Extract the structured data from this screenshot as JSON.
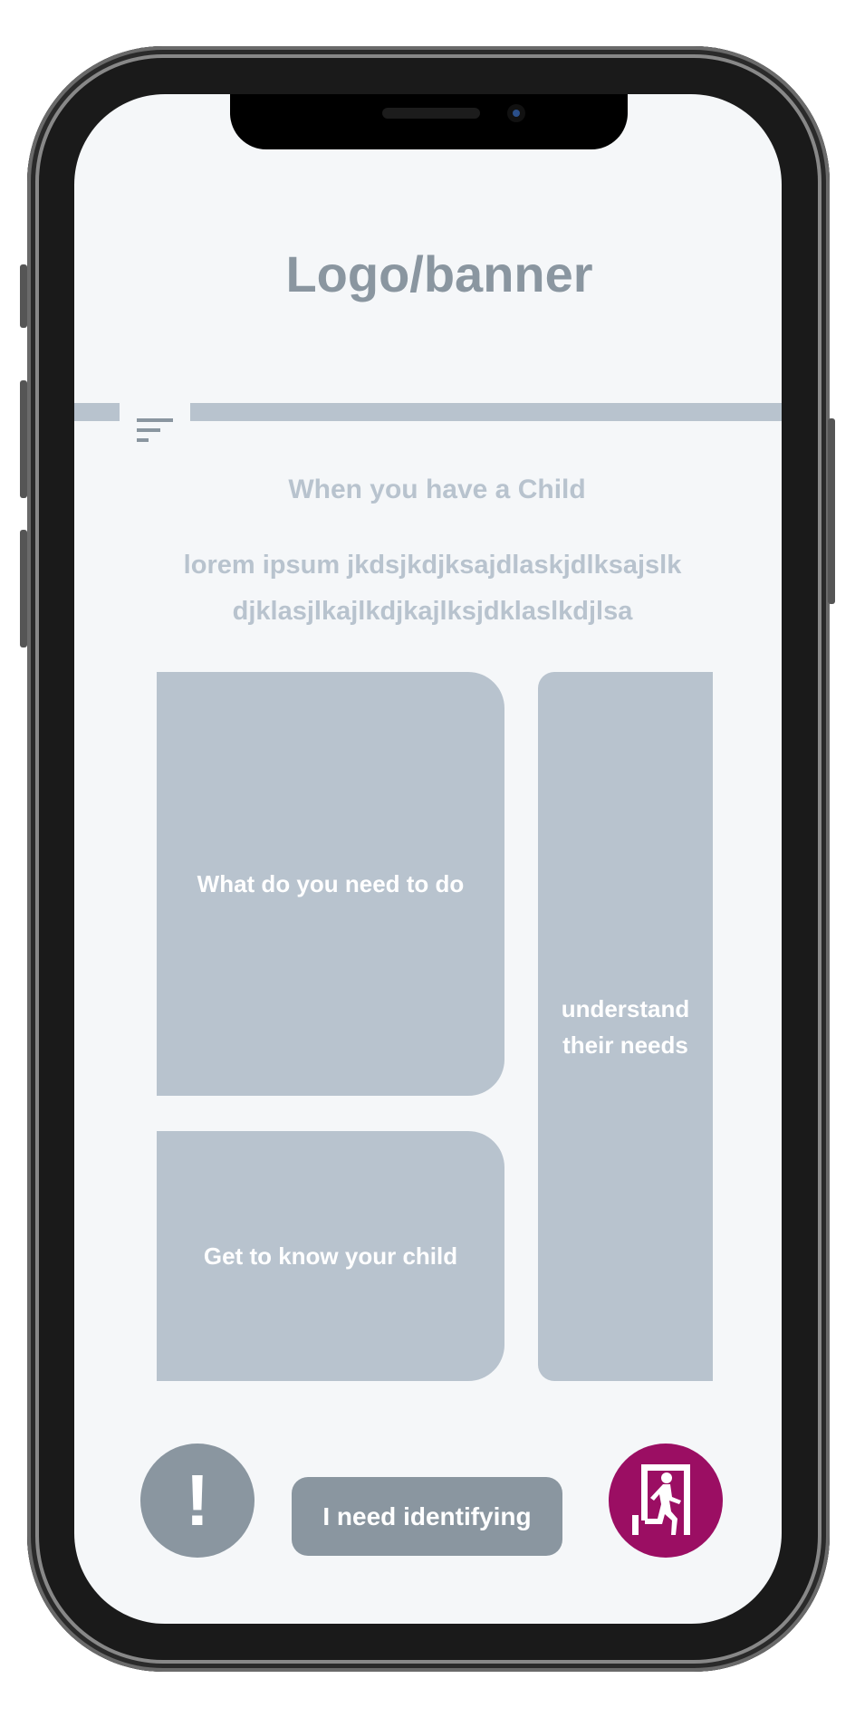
{
  "header": {
    "logo_text": "Logo/banner"
  },
  "nav": {
    "menu_icon": "menu-lines-icon"
  },
  "intro": {
    "title": "When you have a Child",
    "body_line1": "lorem ipsum jkdsjkdjksajdlaskjdlksajslk",
    "body_line2": "djklasjlkajlkdjkajlksjdklaslkdjlsa"
  },
  "cards": [
    {
      "label": "What do you need to do"
    },
    {
      "label": "Get to know your child"
    },
    {
      "label_line1": "understand",
      "label_line2": "their needs"
    }
  ],
  "footer": {
    "alert_icon": "exclamation-icon",
    "identify_label": "I need identifying",
    "exit_icon": "emergency-exit-icon"
  },
  "colors": {
    "background": "#f5f7f9",
    "card": "#b8c3ce",
    "button": "#8a96a0",
    "exit": "#9b0e63"
  }
}
